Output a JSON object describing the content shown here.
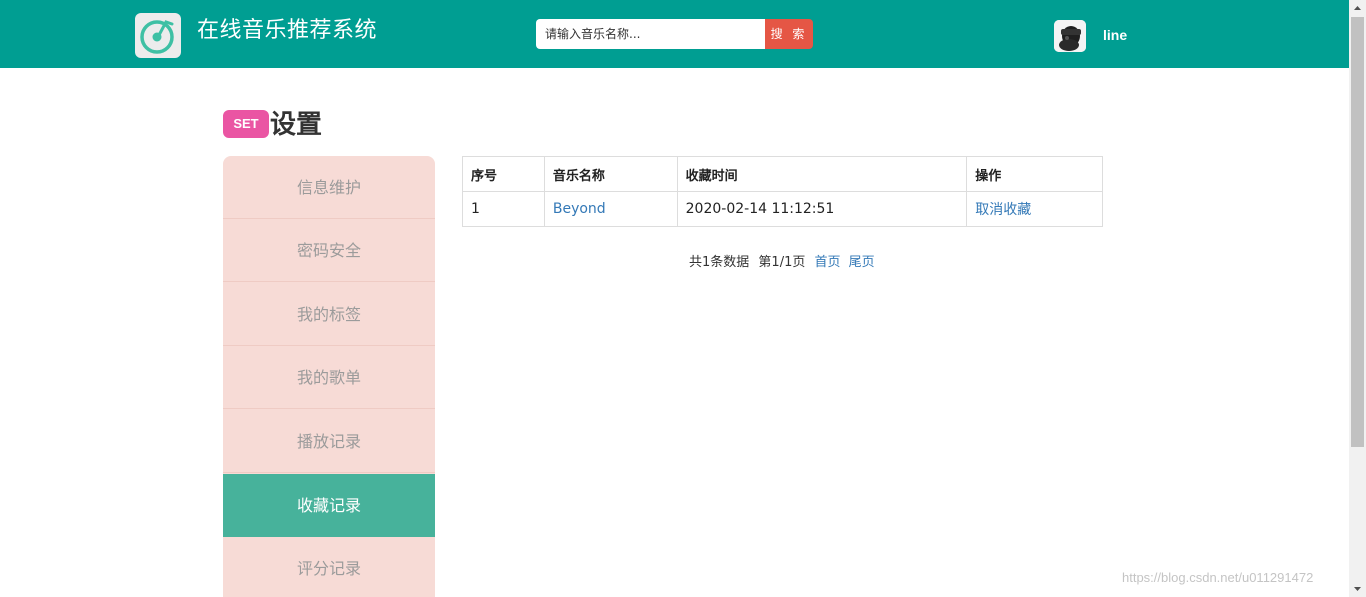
{
  "header": {
    "app_title": "在线音乐推荐系统",
    "search_placeholder": "请输入音乐名称...",
    "search_button": "搜 索",
    "username": "line",
    "brand_color": "#009e92",
    "logo_icon": "music-disc-icon"
  },
  "page": {
    "badge": "SET",
    "title": "设置"
  },
  "sidebar": {
    "items": [
      {
        "label": "信息维护"
      },
      {
        "label": "密码安全"
      },
      {
        "label": "我的标签"
      },
      {
        "label": "我的歌单"
      },
      {
        "label": "播放记录"
      },
      {
        "label": "收藏记录"
      },
      {
        "label": "评分记录"
      }
    ],
    "active": "收藏记录"
  },
  "table": {
    "headers": [
      "序号",
      "音乐名称",
      "收藏时间",
      "操作"
    ],
    "rows": [
      {
        "index": "1",
        "name": "Beyond",
        "time": "2020-02-14 11:12:51",
        "action": "取消收藏"
      }
    ]
  },
  "pagination": {
    "total": "共1条数据",
    "page": "第1/1页",
    "first": "首页",
    "last": "尾页"
  },
  "watermark": "https://blog.csdn.net/u011291472"
}
